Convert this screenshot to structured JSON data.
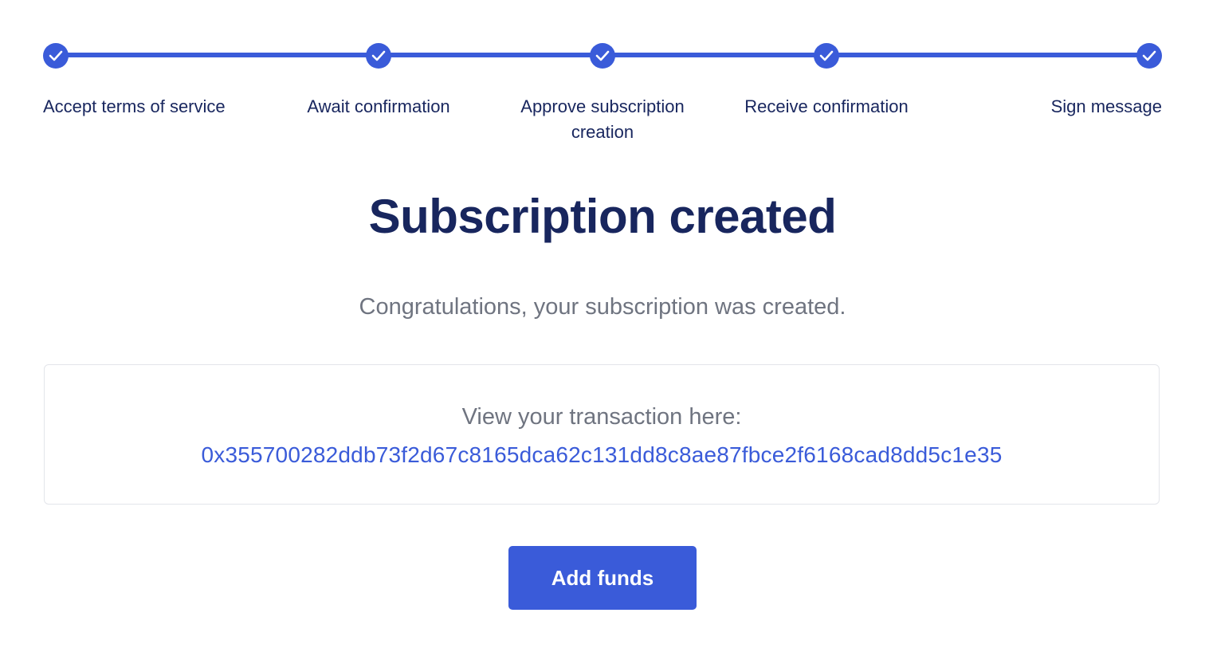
{
  "stepper": {
    "steps": [
      {
        "label": "Accept terms of service",
        "status": "completed",
        "icon": "check-icon"
      },
      {
        "label": "Await confirmation",
        "status": "completed",
        "icon": "check-icon"
      },
      {
        "label": "Approve subscription creation",
        "status": "completed",
        "icon": "check-icon"
      },
      {
        "label": "Receive confirmation",
        "status": "completed",
        "icon": "check-icon"
      },
      {
        "label": "Sign message",
        "status": "completed",
        "icon": "check-icon"
      }
    ]
  },
  "main": {
    "title": "Subscription created",
    "subtitle": "Congratulations, your subscription was created."
  },
  "transaction": {
    "label": "View your transaction here:",
    "hash": "0x355700282ddb73f2d67c8165dca62c131dd8c8ae87fbce2f6168cad8dd5c1e35"
  },
  "actions": {
    "add_funds_label": "Add funds"
  },
  "colors": {
    "accent": "#3a5bd9",
    "heading": "#18265e",
    "muted_text": "#6f7480",
    "card_border": "#e3e5ea"
  }
}
